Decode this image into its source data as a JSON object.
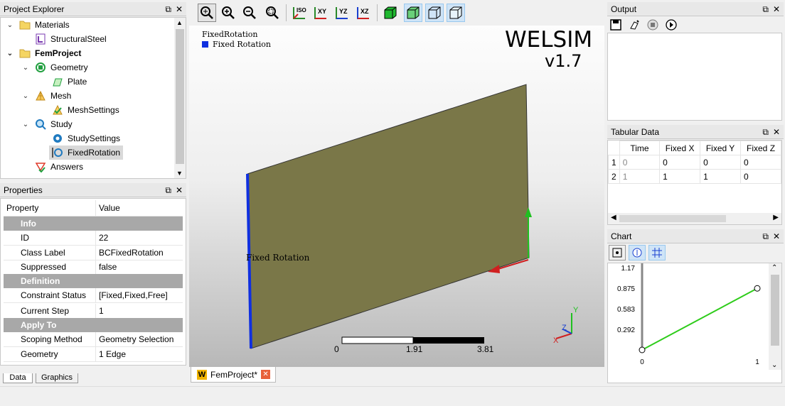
{
  "project_explorer": {
    "title": "Project Explorer",
    "items": [
      {
        "label": "Materials",
        "icon": "folder-icon"
      },
      {
        "label": "StructuralSteel",
        "icon": "material-icon"
      },
      {
        "label": "FemProject",
        "icon": "folder-icon"
      },
      {
        "label": "Geometry",
        "icon": "geometry-icon"
      },
      {
        "label": "Plate",
        "icon": "plate-icon"
      },
      {
        "label": "Mesh",
        "icon": "mesh-icon"
      },
      {
        "label": "MeshSettings",
        "icon": "mesh-settings-icon"
      },
      {
        "label": "Study",
        "icon": "study-icon"
      },
      {
        "label": "StudySettings",
        "icon": "gear-icon"
      },
      {
        "label": "FixedRotation",
        "icon": "fixed-rotation-icon"
      },
      {
        "label": "Answers",
        "icon": "answers-icon"
      }
    ]
  },
  "properties": {
    "title": "Properties",
    "col_property": "Property",
    "col_value": "Value",
    "group_info": "Info",
    "id_label": "ID",
    "id_value": "22",
    "class_label": "Class Label",
    "class_value": "BCFixedRotation",
    "suppressed_label": "Suppressed",
    "suppressed_value": "false",
    "group_definition": "Definition",
    "constraint_label": "Constraint Status",
    "constraint_value": "[Fixed,Fixed,Free]",
    "step_label": "Current Step",
    "step_value": "1",
    "group_apply": "Apply To",
    "scoping_label": "Scoping Method",
    "scoping_value": "Geometry Selection",
    "geometry_label": "Geometry",
    "geometry_value": "1 Edge"
  },
  "bottom_tabs": {
    "data": "Data",
    "graphics": "Graphics"
  },
  "viewport": {
    "legend_title": "FixedRotation",
    "legend_item": "Fixed Rotation",
    "logo_line1": "WELSIM",
    "logo_line2": "v1.7",
    "annotation": "Fixed Rotation",
    "scale_0": "0",
    "scale_mid": "1.91",
    "scale_max": "3.81",
    "axis_x": "X",
    "axis_y": "Y",
    "axis_z": "Z",
    "tab_label": "FemProject*",
    "tab_icon_letter": "W"
  },
  "toolbar": {
    "iso": "ISO",
    "xy": "XY",
    "yz": "YZ",
    "xz": "XZ"
  },
  "output": {
    "title": "Output"
  },
  "tabular": {
    "title": "Tabular Data",
    "headers": [
      "Time",
      "Fixed X",
      "Fixed Y",
      "Fixed Z"
    ],
    "rows": [
      {
        "index": "1",
        "cells": [
          "0",
          "0",
          "0",
          "0"
        ]
      },
      {
        "index": "2",
        "cells": [
          "1",
          "1",
          "1",
          "0"
        ]
      }
    ]
  },
  "chart": {
    "title": "Chart"
  },
  "chart_data": {
    "type": "line",
    "x": [
      0,
      1
    ],
    "series": [
      {
        "values": [
          0,
          0.875
        ]
      }
    ],
    "yticks": [
      "1.17",
      "0.875",
      "0.583",
      "0.292"
    ],
    "xticks": [
      "0",
      "1"
    ],
    "ylim": [
      0,
      1.17
    ],
    "xlim": [
      0,
      1
    ],
    "colors": {
      "line": "#2ecc1a",
      "marker": "#ffffff"
    }
  },
  "colors": {
    "plate": "#7a7748",
    "edge": "#1030e0",
    "accent": "#cfe4f7"
  }
}
